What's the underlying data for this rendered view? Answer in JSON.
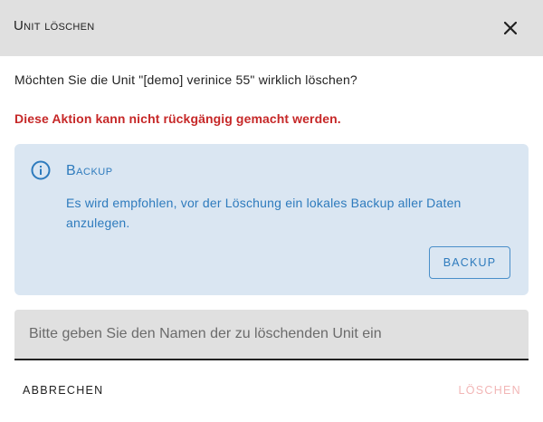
{
  "dialog": {
    "title": "Unit löschen",
    "close_icon": "close-icon",
    "question": "Möchten Sie die Unit \"[demo] verinice 55\" wirklich löschen?",
    "warning": "Diese Aktion kann nicht rückgängig gemacht werden.",
    "info": {
      "icon": "info-icon",
      "title": "Backup",
      "text": "Es wird empfohlen, vor der Löschung ein lokales Backup aller Daten anzulegen.",
      "button_label": "BACKUP"
    },
    "name_input": {
      "value": "",
      "placeholder": "Bitte geben Sie den Namen der zu löschenden Unit ein"
    },
    "actions": {
      "cancel_label": "ABBRECHEN",
      "delete_label": "LÖSCHEN",
      "delete_disabled": true
    }
  },
  "colors": {
    "titlebar_bg": "#e0e0e0",
    "warning": "#c62828",
    "info_bg": "#dae6f2",
    "info_accent": "#2e7bbd",
    "delete_disabled": "#f2b6b6"
  }
}
